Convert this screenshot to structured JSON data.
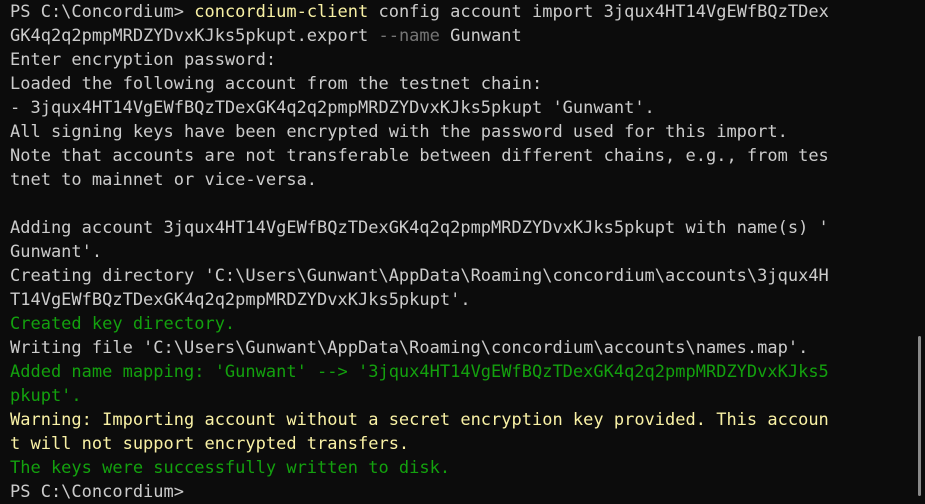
{
  "terminal": {
    "lines": [
      {
        "segments": [
          {
            "text": "PS C:\\Concordium> ",
            "color": "white"
          },
          {
            "text": "concordium-client",
            "color": "yellow"
          },
          {
            "text": " config account import 3jqux4HT14VgEWfBQzTDex",
            "color": "white"
          }
        ]
      },
      {
        "segments": [
          {
            "text": "GK4q2q2pmpMRDZYDvxKJks5pkupt.export ",
            "color": "white"
          },
          {
            "text": "--name",
            "color": "dim"
          },
          {
            "text": " Gunwant",
            "color": "white"
          }
        ]
      },
      {
        "segments": [
          {
            "text": "Enter encryption password:",
            "color": "white"
          }
        ]
      },
      {
        "segments": [
          {
            "text": "Loaded the following account from the testnet chain:",
            "color": "white"
          }
        ]
      },
      {
        "segments": [
          {
            "text": "- 3jqux4HT14VgEWfBQzTDexGK4q2q2pmpMRDZYDvxKJks5pkupt 'Gunwant'.",
            "color": "white"
          }
        ]
      },
      {
        "segments": [
          {
            "text": "All signing keys have been encrypted with the password used for this import.",
            "color": "white"
          }
        ]
      },
      {
        "segments": [
          {
            "text": "Note that accounts are not transferable between different chains, e.g., from tes",
            "color": "white"
          }
        ]
      },
      {
        "segments": [
          {
            "text": "tnet to mainnet or vice-versa.",
            "color": "white"
          }
        ]
      },
      {
        "segments": [
          {
            "text": "",
            "color": "white"
          }
        ]
      },
      {
        "segments": [
          {
            "text": "Adding account 3jqux4HT14VgEWfBQzTDexGK4q2q2pmpMRDZYDvxKJks5pkupt with name(s) '",
            "color": "white"
          }
        ]
      },
      {
        "segments": [
          {
            "text": "Gunwant'.",
            "color": "white"
          }
        ]
      },
      {
        "segments": [
          {
            "text": "Creating directory 'C:\\Users\\Gunwant\\AppData\\Roaming\\concordium\\accounts\\3jqux4H",
            "color": "white"
          }
        ]
      },
      {
        "segments": [
          {
            "text": "T14VgEWfBQzTDexGK4q2q2pmpMRDZYDvxKJks5pkupt'.",
            "color": "white"
          }
        ]
      },
      {
        "segments": [
          {
            "text": "Created key directory.",
            "color": "green"
          }
        ]
      },
      {
        "segments": [
          {
            "text": "Writing file 'C:\\Users\\Gunwant\\AppData\\Roaming\\concordium\\accounts\\names.map'.",
            "color": "white"
          }
        ]
      },
      {
        "segments": [
          {
            "text": "Added name mapping: 'Gunwant' --> '3jqux4HT14VgEWfBQzTDexGK4q2q2pmpMRDZYDvxKJks5",
            "color": "green"
          }
        ]
      },
      {
        "segments": [
          {
            "text": "pkupt'.",
            "color": "green"
          }
        ]
      },
      {
        "segments": [
          {
            "text": "Warning: Importing account without a secret encryption key provided. This accoun",
            "color": "yellow"
          }
        ]
      },
      {
        "segments": [
          {
            "text": "t will not support encrypted transfers.",
            "color": "yellow"
          }
        ]
      },
      {
        "segments": [
          {
            "text": "The keys were successfully written to disk.",
            "color": "green"
          }
        ]
      },
      {
        "segments": [
          {
            "text": "PS C:\\Concordium> ",
            "color": "white"
          }
        ]
      }
    ]
  },
  "colors": {
    "background": "#0c0c0c",
    "white": "#cccccc",
    "yellow": "#f9f1a5",
    "green": "#13a10e",
    "dim": "#767676",
    "scrollbar": "#8a8a8a"
  },
  "scroll": {
    "position_fraction": 1.0
  }
}
